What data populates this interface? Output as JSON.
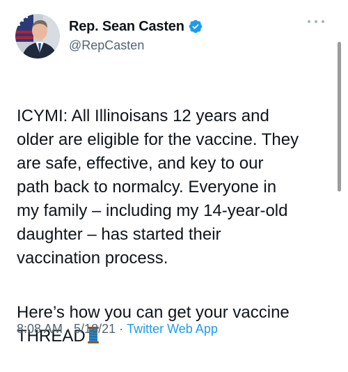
{
  "author": {
    "name": "Rep. Sean Casten",
    "handle": "@RepCasten",
    "verified": true,
    "avatar_icon": "profile-photo"
  },
  "tweet": {
    "paragraph1": "ICYMI: All Illinoisans 12 years and\nolder are eligible for the vaccine. They\nare safe, effective, and key to our\npath back to normalcy. Everyone in\nmy family – including my 14-year-old\ndaughter – has started their\nvaccination process.",
    "paragraph2": "Here’s how you can get your vaccine\nTHREAD",
    "emoji": "spool-of-thread-icon"
  },
  "meta": {
    "time": "8:08 AM",
    "separator": "·",
    "date": "5/18/21",
    "source": "Twitter Web App"
  },
  "colors": {
    "text": "#0f1419",
    "secondary": "#536471",
    "accent": "#1d9bf0"
  }
}
